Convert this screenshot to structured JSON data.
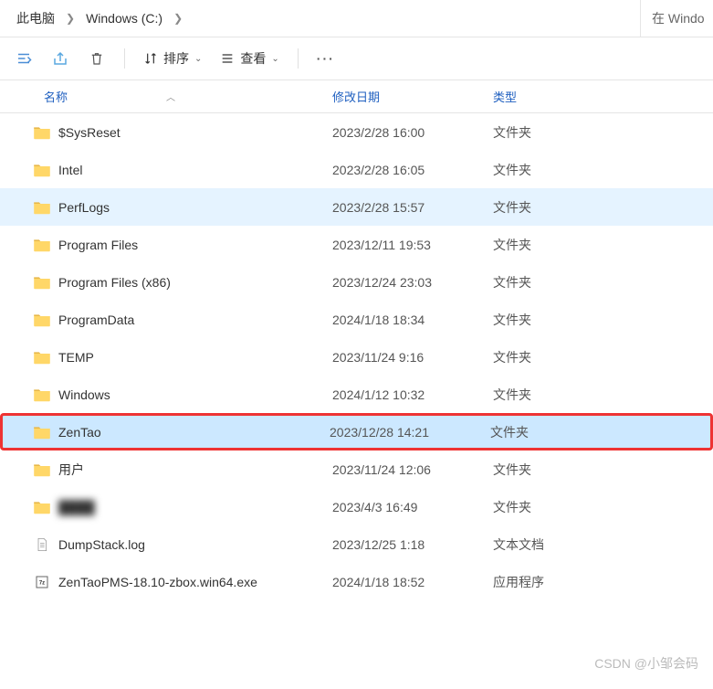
{
  "breadcrumb": {
    "root": "此电脑",
    "drive": "Windows (C:)"
  },
  "search": {
    "placeholder": "在 Windo"
  },
  "toolbar": {
    "sort_label": "排序",
    "view_label": "查看"
  },
  "columns": {
    "name": "名称",
    "date": "修改日期",
    "type": "类型"
  },
  "type_labels": {
    "folder": "文件夹",
    "text": "文本文档",
    "app": "应用程序"
  },
  "rows": [
    {
      "name": "$SysReset",
      "date": "2023/2/28 16:00",
      "type": "folder",
      "state": ""
    },
    {
      "name": "Intel",
      "date": "2023/2/28 16:05",
      "type": "folder",
      "state": ""
    },
    {
      "name": "PerfLogs",
      "date": "2023/2/28 15:57",
      "type": "folder",
      "state": "hover"
    },
    {
      "name": "Program Files",
      "date": "2023/12/11 19:53",
      "type": "folder",
      "state": ""
    },
    {
      "name": "Program Files (x86)",
      "date": "2023/12/24 23:03",
      "type": "folder",
      "state": ""
    },
    {
      "name": "ProgramData",
      "date": "2024/1/18 18:34",
      "type": "folder",
      "state": ""
    },
    {
      "name": "TEMP",
      "date": "2023/11/24 9:16",
      "type": "folder",
      "state": ""
    },
    {
      "name": "Windows",
      "date": "2024/1/12 10:32",
      "type": "folder",
      "state": ""
    },
    {
      "name": "ZenTao",
      "date": "2023/12/28 14:21",
      "type": "folder",
      "state": "highlighted"
    },
    {
      "name": "用户",
      "date": "2023/11/24 12:06",
      "type": "folder",
      "state": ""
    },
    {
      "name": "████",
      "date": "2023/4/3 16:49",
      "type": "folder",
      "state": "",
      "blur": true
    },
    {
      "name": "DumpStack.log",
      "date": "2023/12/25 1:18",
      "type": "text",
      "state": ""
    },
    {
      "name": "ZenTaoPMS-18.10-zbox.win64.exe",
      "date": "2024/1/18 18:52",
      "type": "app",
      "state": ""
    }
  ],
  "watermark": "CSDN @小邹会码"
}
